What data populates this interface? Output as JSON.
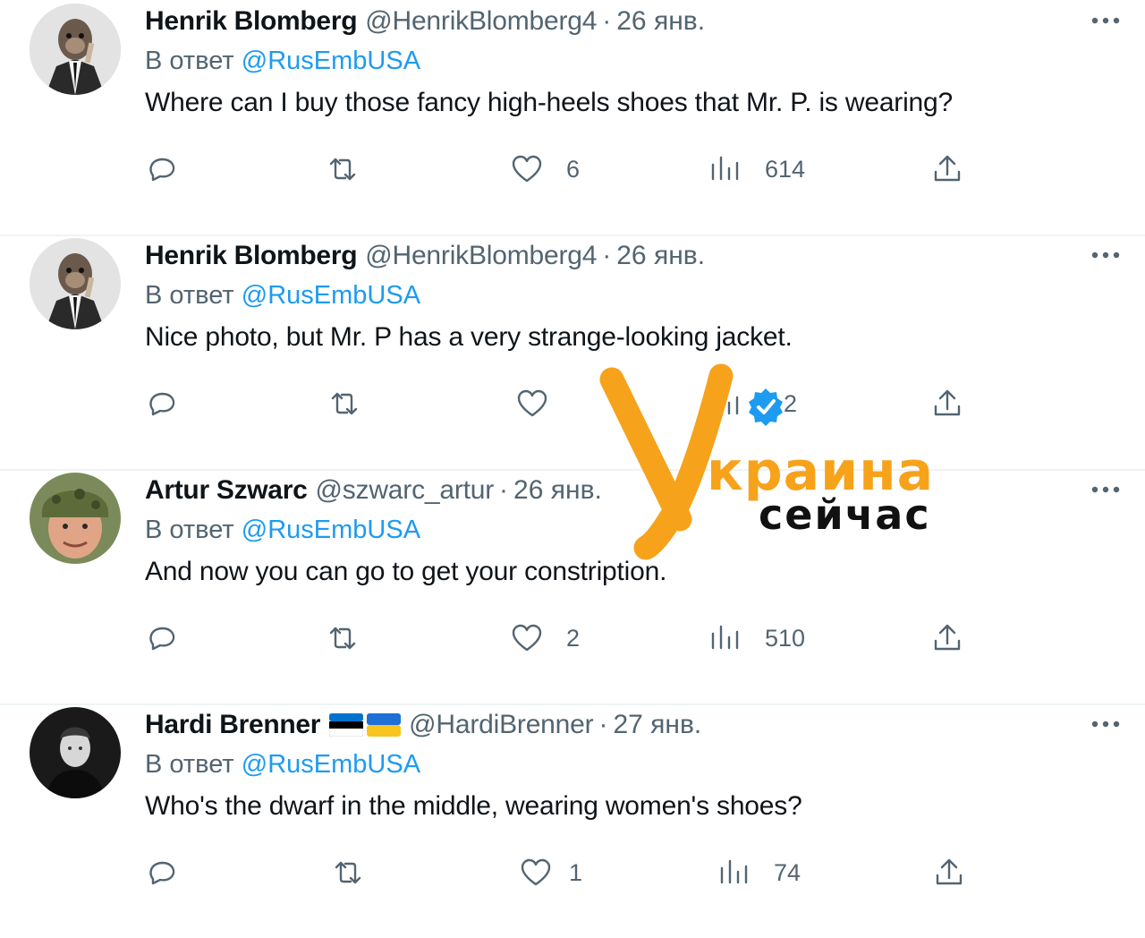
{
  "tweets": [
    {
      "name": "Henrik Blomberg",
      "handle": "@HenrikBlomberg4",
      "separator": "·",
      "date": "26 янв.",
      "reply_prefix": "В ответ",
      "reply_to": "@RusEmbUSA",
      "text": "Where can I buy those fancy high-heels shoes that Mr. P. is wearing?",
      "likes": "6",
      "views": "614",
      "avatar": "monkey-in-suit"
    },
    {
      "name": "Henrik Blomberg",
      "handle": "@HenrikBlomberg4",
      "separator": "·",
      "date": "26 янв.",
      "reply_prefix": "В ответ",
      "reply_to": "@RusEmbUSA",
      "text": "Nice photo, but Mr. P has a very strange-looking jacket.",
      "likes": "",
      "views": "2",
      "avatar": "monkey-in-suit"
    },
    {
      "name": "Artur Szwarc",
      "handle": "@szwarc_artur",
      "separator": "·",
      "date": "26 янв.",
      "reply_prefix": "В ответ",
      "reply_to": "@RusEmbUSA",
      "text": "And now you can go to get your constription.",
      "likes": "2",
      "views": "510",
      "avatar": "soldier-helmet"
    },
    {
      "name": "Hardi Brenner",
      "handle": "@HardiBrenner",
      "separator": "·",
      "date": "27 янв.",
      "reply_prefix": "В ответ",
      "reply_to": "@RusEmbUSA",
      "text": "Who's the dwarf in the middle, wearing women's shoes?",
      "likes": "1",
      "views": "74",
      "avatar": "man-portrait-bw",
      "flags": [
        "estonia-flag",
        "ukraine-flag"
      ]
    }
  ],
  "watermark": {
    "line1": "краина",
    "line2": "сейчас",
    "logo_letter": "У",
    "badge": "verified-badge-icon"
  },
  "colors": {
    "accent": "#1d9bf0",
    "secondary_text": "#536471",
    "watermark_orange": "#f7a21b"
  }
}
